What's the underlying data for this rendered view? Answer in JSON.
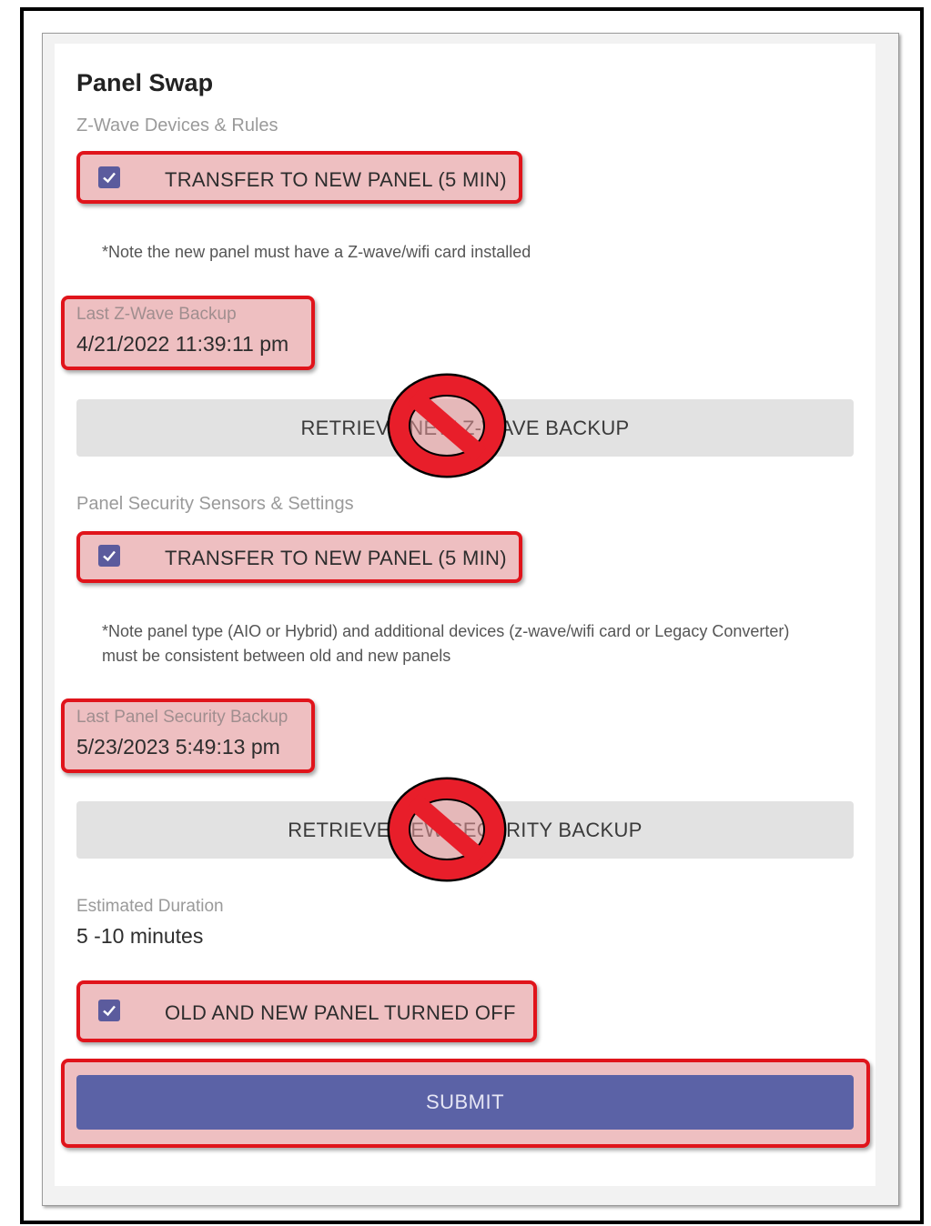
{
  "title": "Panel Swap",
  "zwave": {
    "section_label": "Z-Wave Devices & Rules",
    "transfer_label": "TRANSFER TO NEW PANEL (5 MIN)",
    "transfer_checked": true,
    "note": "*Note the new panel must have a Z-wave/wifi card installed",
    "last_backup_label": "Last Z-Wave Backup",
    "last_backup_value": "4/21/2022 11:39:11 pm",
    "retrieve_label": "RETRIEVE NEW Z-WAVE BACKUP"
  },
  "security": {
    "section_label": "Panel Security Sensors & Settings",
    "transfer_label": "TRANSFER TO NEW PANEL (5 MIN)",
    "transfer_checked": true,
    "note_line1": "*Note panel type (AIO or Hybrid) and additional devices (z-wave/wifi card or Legacy Converter)",
    "note_line2": "must be consistent between old and new panels",
    "last_backup_label": "Last Panel Security Backup",
    "last_backup_value": "5/23/2023 5:49:13 pm",
    "retrieve_label": "RETRIEVE NEW SECURITY BACKUP"
  },
  "duration": {
    "label": "Estimated Duration",
    "value": "5 -10 minutes"
  },
  "confirm": {
    "label": "OLD AND NEW PANEL TURNED OFF",
    "checked": true
  },
  "submit_label": "SUBMIT",
  "colors": {
    "accent": "#5b62a6",
    "checkbox": "#5b5b9d",
    "highlight_border": "#e0141b",
    "highlight_fill": "#e8aaac"
  },
  "icons": {
    "prohibited": "no-sign-icon",
    "checkbox": "checkmark-icon"
  }
}
